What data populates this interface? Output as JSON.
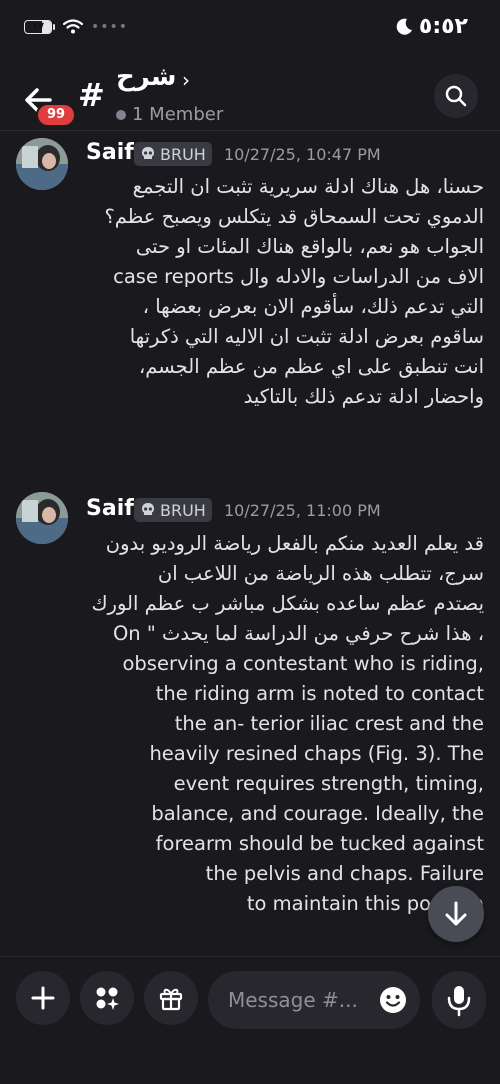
{
  "status": {
    "battery": "١٧",
    "time": "٥:٥٢"
  },
  "header": {
    "back_badge": "99",
    "channel_prefix": "#",
    "channel_name": "شرح",
    "members": "1 Member"
  },
  "messages": [
    {
      "author": "Saif",
      "tag": "BRUH",
      "timestamp": "10/27/25, 10:47 PM",
      "lines": [
        "حسنا، هل هناك ادلة سريرية تثبت ان التجمع",
        "الدموي تحت السمحاق قد يتكلس ويصبح عظم؟",
        "الجواب هو نعم، بالواقع هناك المئات او حتى",
        "الاف من الدراسات والادله وال case reports",
        "التي تدعم ذلك، سأقوم الان بعرض بعضها ،",
        "ساقوم بعرض ادلة تثبت ان الاليه التي ذكرتها",
        "انت تنطبق على اي عظم من عظم الجسم،",
        "واحضار ادلة تدعم ذلك بالتاكيد"
      ]
    },
    {
      "author": "Saif",
      "tag": "BRUH",
      "timestamp": "10/27/25, 11:00 PM",
      "lines": [
        "قد يعلم العديد منكم بالفعل رياضة الروديو بدون",
        "سرج، تتطلب هذه الرياضة من اللاعب ان",
        "يصتدم عظم ساعده بشكل مباشر ب عظم الورك",
        "، هذا شرح حرفي من الدراسة لما يحدث \" On",
        "observing a contestant who is riding,",
        "the riding arm is noted to contact",
        "the an- terior iliac crest and the",
        "heavily resined chaps (Fig. 3). The",
        "event requires strength, timing,",
        "balance, and courage. Ideally, the",
        "forearm should be tucked against",
        "the pelvis and chaps. Failure",
        "to maintain this position"
      ]
    }
  ],
  "composer": {
    "placeholder": "Message #..."
  }
}
